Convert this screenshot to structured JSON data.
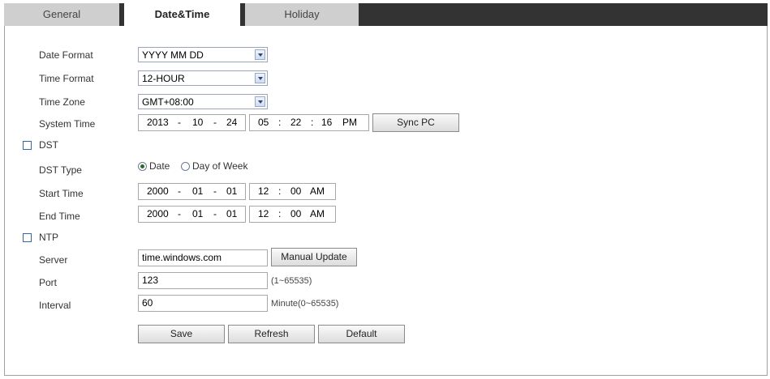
{
  "tabs": [
    {
      "label": "General"
    },
    {
      "label": "Date&Time"
    },
    {
      "label": "Holiday"
    }
  ],
  "date_format": {
    "label": "Date Format",
    "value": "YYYY MM DD"
  },
  "time_format": {
    "label": "Time Format",
    "value": "12-HOUR"
  },
  "time_zone": {
    "label": "Time Zone",
    "value": "GMT+08:00"
  },
  "system_time": {
    "label": "System Time",
    "year": "2013",
    "month": "10",
    "day": "24",
    "hour": "05",
    "minute": "22",
    "second": "16",
    "ampm": "PM",
    "sync_button": "Sync PC"
  },
  "dst": {
    "label": "DST",
    "type_label": "DST Type",
    "option_date": "Date",
    "option_dow": "Day of Week",
    "selected": "Date",
    "start": {
      "label": "Start Time",
      "year": "2000",
      "month": "01",
      "day": "01",
      "hour": "12",
      "minute": "00",
      "ampm": "AM"
    },
    "end": {
      "label": "End Time",
      "year": "2000",
      "month": "01",
      "day": "01",
      "hour": "12",
      "minute": "00",
      "ampm": "AM"
    }
  },
  "ntp": {
    "label": "NTP",
    "server_label": "Server",
    "server_value": "time.windows.com",
    "manual_update": "Manual Update",
    "port_label": "Port",
    "port_value": "123",
    "port_hint": "(1~65535)",
    "interval_label": "Interval",
    "interval_value": "60",
    "interval_hint": "Minute(0~65535)"
  },
  "buttons": {
    "save": "Save",
    "refresh": "Refresh",
    "default": "Default"
  },
  "separators": {
    "date": "-",
    "time": ":"
  }
}
